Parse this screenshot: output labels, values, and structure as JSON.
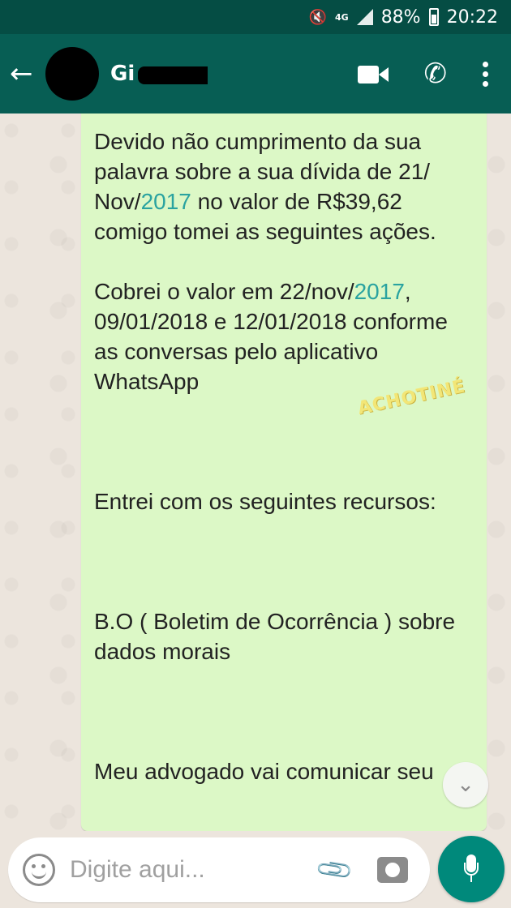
{
  "status_bar": {
    "network": "4G",
    "battery": "88%",
    "time": "20:22"
  },
  "header": {
    "back_icon": "arrow-left-icon",
    "contact_name": "Gi",
    "icons": [
      "video-call-icon",
      "phone-call-icon",
      "more-options-icon"
    ]
  },
  "message": {
    "p1_before": "Devido não cumprimento da sua palavra sobre a sua dívida de 21/ Nov/",
    "p1_year": "2017",
    "p1_after": " no valor de R$39,62 comigo tomei as seguintes ações.",
    "p2_before": "Cobrei o valor em 22/nov/",
    "p2_year": "2017",
    "p2_after": ", 09/01/2018 e 12/01/2018 conforme as conversas pelo aplicativo WhatsApp",
    "p3": "Entrei com os seguintes recursos:",
    "p4": "B.O ( Boletim de Ocorrência ) sobre dados morais",
    "p5": "Meu advogado vai comunicar seu"
  },
  "watermark": "ACHOTINÉ",
  "input": {
    "placeholder": "Digite aqui..."
  },
  "colors": {
    "app_bar": "#075e54",
    "status_bar": "#054d44",
    "bubble": "#dcf8c6",
    "link_year": "#2aa3a0",
    "mic_button": "#00897b"
  }
}
